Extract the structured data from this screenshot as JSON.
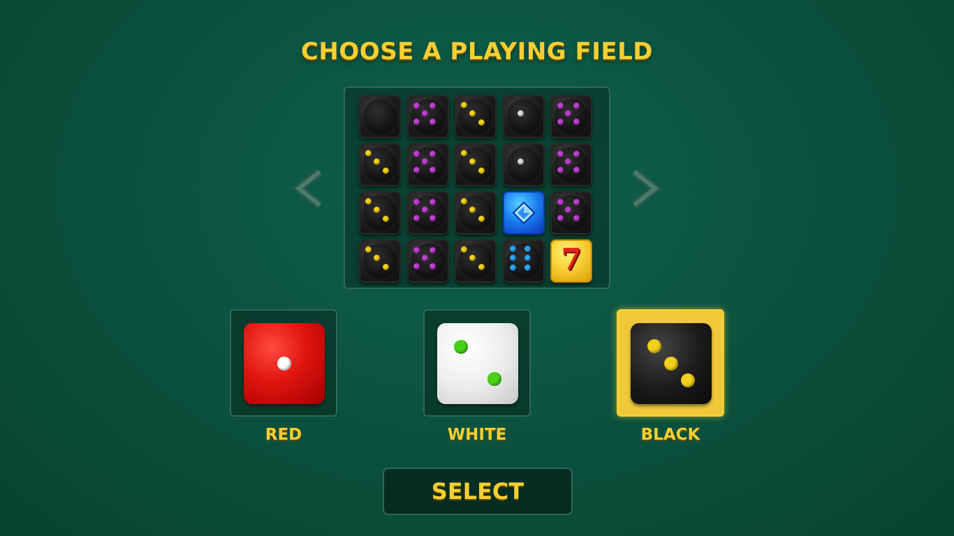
{
  "title": "CHOOSE A PLAYING FIELD",
  "playing_field": {
    "pip_colors": {
      "purple": "#c23fd6",
      "yellow": "#f3d21c",
      "white": "#dcdcdc",
      "blue": "#2aa8ff"
    },
    "rows": [
      [
        {
          "face": 0,
          "pip": "none"
        },
        {
          "face": 5,
          "pip": "purple"
        },
        {
          "face": 3,
          "pip": "yellow"
        },
        {
          "face": 1,
          "pip": "white"
        },
        {
          "face": 5,
          "pip": "purple"
        }
      ],
      [
        {
          "face": 3,
          "pip": "yellow"
        },
        {
          "face": 5,
          "pip": "purple"
        },
        {
          "face": 3,
          "pip": "yellow"
        },
        {
          "face": 1,
          "pip": "white"
        },
        {
          "face": 5,
          "pip": "purple"
        }
      ],
      [
        {
          "face": 3,
          "pip": "yellow"
        },
        {
          "face": 5,
          "pip": "purple"
        },
        {
          "face": 3,
          "pip": "yellow"
        },
        {
          "face": "gem",
          "pip": "blue"
        },
        {
          "face": 5,
          "pip": "purple"
        }
      ],
      [
        {
          "face": 3,
          "pip": "yellow"
        },
        {
          "face": 5,
          "pip": "purple"
        },
        {
          "face": 3,
          "pip": "yellow"
        },
        {
          "face": 6,
          "pip": "blue"
        },
        {
          "face": "seven",
          "pip": "none"
        }
      ]
    ],
    "seven_text": "7"
  },
  "navigation": {
    "prev_icon": "chevron-left-icon",
    "next_icon": "chevron-right-icon",
    "arrow_color": "#3f6e61"
  },
  "dice_colors": {
    "options": [
      {
        "label": "RED",
        "pip_color": "#ffffff",
        "selected": false
      },
      {
        "label": "WHITE",
        "pip_color": "#49d117",
        "selected": false
      },
      {
        "label": "BLACK",
        "pip_color": "#f3d21c",
        "selected": true
      }
    ]
  },
  "select_button": {
    "label": "SELECT"
  },
  "theme": {
    "accent": "#f6cf34",
    "panel_border": "#2f6a58",
    "felt": "#0b5440"
  }
}
